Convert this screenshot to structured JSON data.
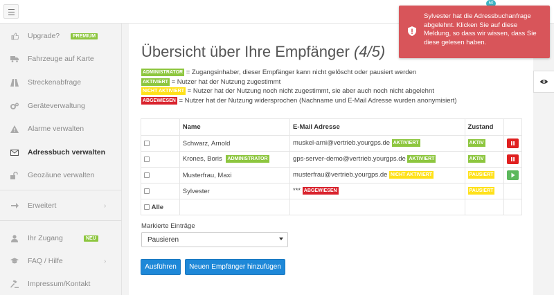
{
  "header": {
    "notification_count": "50"
  },
  "sidebar": {
    "items": [
      {
        "label": "Upgrade?",
        "tag": "PREMIUM"
      },
      {
        "label": "Fahrzeuge auf Karte"
      },
      {
        "label": "Streckenabfrage"
      },
      {
        "label": "Geräteverwaltung"
      },
      {
        "label": "Alarme verwalten"
      },
      {
        "label": "Adressbuch verwalten"
      },
      {
        "label": "Geozäune verwalten"
      },
      {
        "label": "Erweitert"
      },
      {
        "label": "Ihr Zugang",
        "tag": "NEU"
      },
      {
        "label": "FAQ / Hilfe"
      },
      {
        "label": "Impressum/Kontakt"
      }
    ]
  },
  "main": {
    "title": "Übersicht über Ihre Empfänger",
    "title_count": "(4/5)",
    "legend": [
      {
        "tag": "ADMINISTRATOR",
        "text": " = Zugangsinhaber, dieser Empfänger kann nicht gelöscht oder pausiert werden"
      },
      {
        "tag": "AKTIVIERT",
        "text": " = Nutzer hat der Nutzung zugestimmt"
      },
      {
        "tag": "NICHT AKTIVIERT",
        "text": " = Nutzer hat der Nutzung noch nicht zugestimmt, sie aber auch noch nicht abgelehnt"
      },
      {
        "tag": "ABGEWIESEN",
        "text": " = Nutzer hat der Nutzung widersprochen (Nachname und E-Mail Adresse wurden anonymisiert)"
      }
    ],
    "table": {
      "headers": [
        "Name",
        "E-Mail Adresse",
        "Zustand"
      ],
      "rows": [
        {
          "name": "Schwarz, Arnold",
          "name_tag": "",
          "email": "muskel-arni@vertrieb.yourgps.de",
          "email_tag": "AKTIVIERT",
          "state": "AKTIV",
          "action": "pause"
        },
        {
          "name": "Krones, Boris",
          "name_tag": "ADMINISTRATOR",
          "email": "gps-server-demo@vertrieb.yourgps.de",
          "email_tag": "AKTIVIERT",
          "state": "AKTIV",
          "action": "pause"
        },
        {
          "name": "Musterfrau, Maxi",
          "name_tag": "",
          "email": "musterfrau@vertrieb.yourgps.de",
          "email_tag": "NICHT AKTIVIERT",
          "state": "PAUSIERT",
          "action": "play"
        },
        {
          "name": "Sylvester",
          "name_tag": "",
          "email": "***",
          "email_tag": "ABGEWIESEN",
          "state": "PAUSIERT",
          "action": ""
        }
      ],
      "select_all_label": "Alle"
    },
    "marked_label": "Markierte Einträge",
    "marked_select_value": "Pausieren",
    "execute_button": "Ausführen",
    "add_button": "Neuen Empfänger hinzufügen"
  },
  "toast": {
    "message": "Sylvester hat die Adressbuchanfrage abgelehnt. Klicken Sie auf diese Meldung, so dass wir wissen, dass Sie diese gelesen haben."
  },
  "colors": {
    "green": "#8dc63f",
    "yellow": "#ffe11a",
    "red": "#d9232d",
    "primary": "#1e88d8",
    "toast": "#d8555a"
  }
}
